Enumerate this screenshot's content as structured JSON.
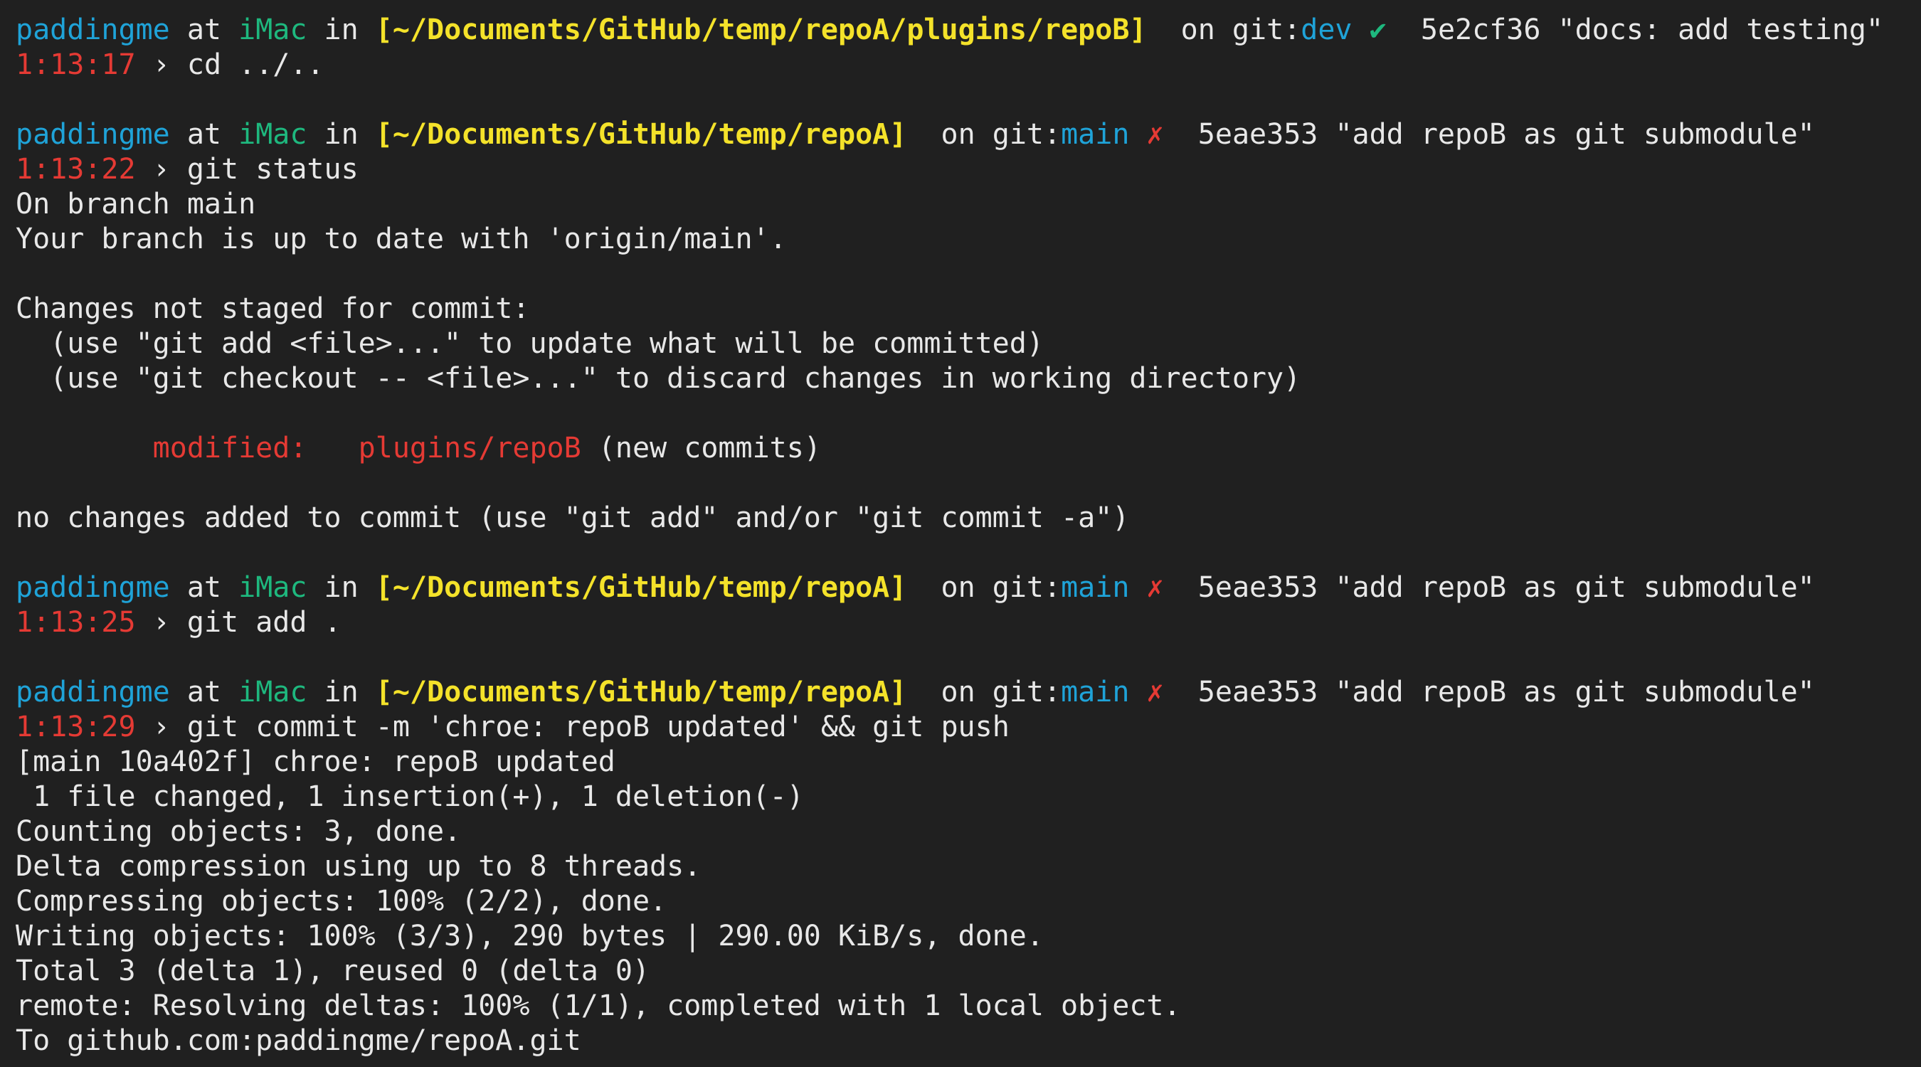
{
  "prompt_labels": {
    "at": "at",
    "in": "in",
    "on_git": "on git:",
    "arrow": "›"
  },
  "colors": {
    "background": "#202020",
    "text": "#e8e8e8",
    "user": "#1fa3d8",
    "host": "#1eb87e",
    "path": "#f4e22a",
    "branch": "#1fa3d8",
    "clean_mark": "#1eb87e",
    "dirty_mark": "#e53a34",
    "time": "#e53a34"
  },
  "blocks": [
    {
      "prompt": {
        "user": "paddingme",
        "host": "iMac",
        "path": "[~/Documents/GitHub/temp/repoA/plugins/repoB]",
        "branch": "dev",
        "status_mark": "✔",
        "commit": "5e2cf36 \"docs: add testing\""
      },
      "time": "1:13:17",
      "command": "cd ../..",
      "output": []
    },
    {
      "prompt": {
        "user": "paddingme",
        "host": "iMac",
        "path": "[~/Documents/GitHub/temp/repoA]",
        "branch": "main",
        "status_mark": "✗",
        "commit": "5eae353 \"add repoB as git submodule\""
      },
      "time": "1:13:22",
      "command": "git status",
      "output": [
        "On branch main",
        "Your branch is up to date with 'origin/main'.",
        "",
        "Changes not staged for commit:",
        "  (use \"git add <file>...\" to update what will be committed)",
        "  (use \"git checkout -- <file>...\" to discard changes in working directory)",
        "",
        "MODIFIED_LINE",
        "",
        "no changes added to commit (use \"git add\" and/or \"git commit -a\")"
      ],
      "modified": {
        "label": "modified:",
        "path": "plugins/repoB",
        "note": "(new commits)"
      }
    },
    {
      "prompt": {
        "user": "paddingme",
        "host": "iMac",
        "path": "[~/Documents/GitHub/temp/repoA]",
        "branch": "main",
        "status_mark": "✗",
        "commit": "5eae353 \"add repoB as git submodule\""
      },
      "time": "1:13:25",
      "command": "git add .",
      "output": []
    },
    {
      "prompt": {
        "user": "paddingme",
        "host": "iMac",
        "path": "[~/Documents/GitHub/temp/repoA]",
        "branch": "main",
        "status_mark": "✗",
        "commit": "5eae353 \"add repoB as git submodule\""
      },
      "time": "1:13:29",
      "command": "git commit -m 'chroe: repoB updated' && git push",
      "output": [
        "[main 10a402f] chroe: repoB updated",
        " 1 file changed, 1 insertion(+), 1 deletion(-)",
        "Counting objects: 3, done.",
        "Delta compression using up to 8 threads.",
        "Compressing objects: 100% (2/2), done.",
        "Writing objects: 100% (3/3), 290 bytes | 290.00 KiB/s, done.",
        "Total 3 (delta 1), reused 0 (delta 0)",
        "remote: Resolving deltas: 100% (1/1), completed with 1 local object.",
        "To github.com:paddingme/repoA.git"
      ]
    }
  ]
}
